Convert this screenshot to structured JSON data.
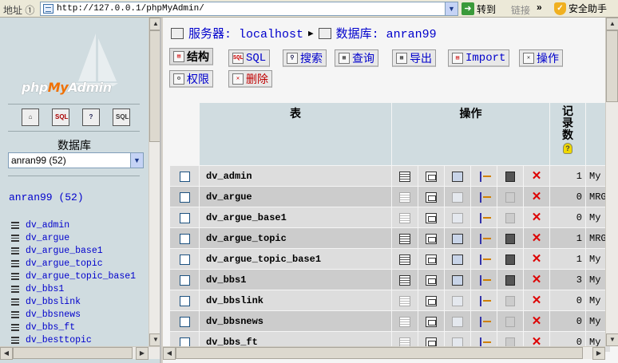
{
  "browser": {
    "address_label": "地址 ①",
    "url": "http://127.0.0.1/phpMyAdmin/",
    "go_label": "转到",
    "links_label": "链接",
    "links_chevron": "»",
    "assistant_label": "安全助手"
  },
  "sidebar": {
    "logo": {
      "php": "php",
      "my": "My",
      "admin": "Admin"
    },
    "icons": [
      "home-icon",
      "sql-icon",
      "help-icon",
      "sql-docs-icon"
    ],
    "db_label": "数据库",
    "db_select_value": "anran99 (52)",
    "db_heading": "anran99 (52)",
    "tables": [
      "dv_admin",
      "dv_argue",
      "dv_argue_base1",
      "dv_argue_topic",
      "dv_argue_topic_base1",
      "dv_bbs1",
      "dv_bbslink",
      "dv_bbsnews",
      "dv_bbs_ft",
      "dv_besttopic"
    ]
  },
  "main": {
    "breadcrumb": {
      "server_label": "服务器: localhost",
      "sep": "▶",
      "db_label": "数据库: anran99"
    },
    "tabs": [
      {
        "label": "结构",
        "icon": "structure-icon",
        "active": true
      },
      {
        "label": "SQL",
        "icon": "sql-icon",
        "active": false
      },
      {
        "label": "搜索",
        "icon": "search-icon",
        "active": false
      },
      {
        "label": "查询",
        "icon": "query-icon",
        "active": false
      },
      {
        "label": "导出",
        "icon": "export-icon",
        "active": false
      },
      {
        "label": "Import",
        "icon": "import-icon",
        "active": false
      },
      {
        "label": "操作",
        "icon": "operations-icon",
        "active": false
      },
      {
        "label": "权限",
        "icon": "privileges-icon",
        "active": false
      },
      {
        "label": "删除",
        "icon": "drop-icon",
        "active": false
      }
    ],
    "table_headers": {
      "table": "表",
      "actions": "操作",
      "records": "记录数"
    },
    "rows": [
      {
        "name": "dv_admin",
        "records": "1",
        "type": "My",
        "has_rows": true
      },
      {
        "name": "dv_argue",
        "records": "0",
        "type": "MRG",
        "has_rows": false
      },
      {
        "name": "dv_argue_base1",
        "records": "0",
        "type": "My",
        "has_rows": false
      },
      {
        "name": "dv_argue_topic",
        "records": "1",
        "type": "MRG",
        "has_rows": true
      },
      {
        "name": "dv_argue_topic_base1",
        "records": "1",
        "type": "My",
        "has_rows": true
      },
      {
        "name": "dv_bbs1",
        "records": "3",
        "type": "My",
        "has_rows": true
      },
      {
        "name": "dv_bbslink",
        "records": "0",
        "type": "My",
        "has_rows": false
      },
      {
        "name": "dv_bbsnews",
        "records": "0",
        "type": "My",
        "has_rows": false
      },
      {
        "name": "dv_bbs_ft",
        "records": "0",
        "type": "My",
        "has_rows": false
      }
    ]
  }
}
